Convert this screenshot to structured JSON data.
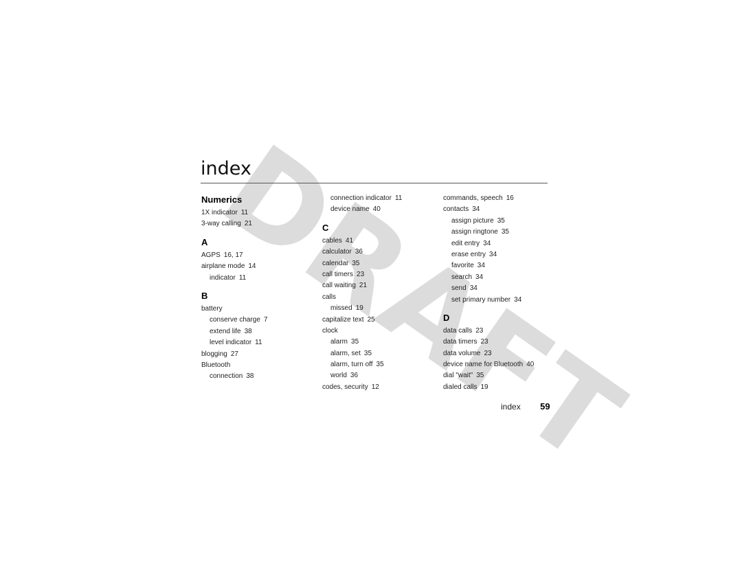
{
  "watermark": "DRAFT",
  "page_title": "index",
  "columns": [
    {
      "blocks": [
        {
          "heading": "Numerics",
          "entries": [
            {
              "term": "1X indicator",
              "pages": "11",
              "sub": false
            },
            {
              "term": "3-way calling",
              "pages": "21",
              "sub": false
            }
          ]
        },
        {
          "heading": "A",
          "entries": [
            {
              "term": "AGPS",
              "pages": "16, 17",
              "sub": false
            },
            {
              "term": "airplane mode",
              "pages": "14",
              "sub": false
            },
            {
              "term": "indicator",
              "pages": "11",
              "sub": true
            }
          ]
        },
        {
          "heading": "B",
          "entries": [
            {
              "term": "battery",
              "pages": "",
              "sub": false
            },
            {
              "term": "conserve charge",
              "pages": "7",
              "sub": true
            },
            {
              "term": "extend life",
              "pages": "38",
              "sub": true
            },
            {
              "term": "level indicator",
              "pages": "11",
              "sub": true
            },
            {
              "term": "blogging",
              "pages": "27",
              "sub": false
            },
            {
              "term": "Bluetooth",
              "pages": "",
              "sub": false
            },
            {
              "term": "connection",
              "pages": "38",
              "sub": true
            }
          ]
        }
      ]
    },
    {
      "blocks": [
        {
          "heading": "",
          "entries": [
            {
              "term": "connection indicator",
              "pages": "11",
              "sub": true
            },
            {
              "term": "device name",
              "pages": "40",
              "sub": true
            }
          ]
        },
        {
          "heading": "C",
          "entries": [
            {
              "term": "cables",
              "pages": "41",
              "sub": false
            },
            {
              "term": "calculator",
              "pages": "36",
              "sub": false
            },
            {
              "term": "calendar",
              "pages": "35",
              "sub": false
            },
            {
              "term": "call timers",
              "pages": "23",
              "sub": false
            },
            {
              "term": "call waiting",
              "pages": "21",
              "sub": false
            },
            {
              "term": "calls",
              "pages": "",
              "sub": false
            },
            {
              "term": "missed",
              "pages": "19",
              "sub": true
            },
            {
              "term": "capitalize text",
              "pages": "25",
              "sub": false
            },
            {
              "term": "clock",
              "pages": "",
              "sub": false
            },
            {
              "term": "alarm",
              "pages": "35",
              "sub": true
            },
            {
              "term": "alarm, set",
              "pages": "35",
              "sub": true
            },
            {
              "term": "alarm, turn off",
              "pages": "35",
              "sub": true
            },
            {
              "term": "world",
              "pages": "36",
              "sub": true
            },
            {
              "term": "codes, security",
              "pages": "12",
              "sub": false
            }
          ]
        }
      ]
    },
    {
      "blocks": [
        {
          "heading": "",
          "entries": [
            {
              "term": "commands, speech",
              "pages": "16",
              "sub": false
            },
            {
              "term": "contacts",
              "pages": "34",
              "sub": false
            },
            {
              "term": "assign picture",
              "pages": "35",
              "sub": true
            },
            {
              "term": "assign ringtone",
              "pages": "35",
              "sub": true
            },
            {
              "term": "edit entry",
              "pages": "34",
              "sub": true
            },
            {
              "term": "erase entry",
              "pages": "34",
              "sub": true
            },
            {
              "term": "favorite",
              "pages": "34",
              "sub": true
            },
            {
              "term": "search",
              "pages": "34",
              "sub": true
            },
            {
              "term": "send",
              "pages": "34",
              "sub": true
            },
            {
              "term": "set primary number",
              "pages": "34",
              "sub": true
            }
          ]
        },
        {
          "heading": "D",
          "entries": [
            {
              "term": "data calls",
              "pages": "23",
              "sub": false
            },
            {
              "term": "data timers",
              "pages": "23",
              "sub": false
            },
            {
              "term": "data volume",
              "pages": "23",
              "sub": false
            },
            {
              "term": "device name for Bluetooth",
              "pages": "40",
              "sub": false
            },
            {
              "term": "dial \"wait\"",
              "pages": "35",
              "sub": false
            },
            {
              "term": "dialed calls",
              "pages": "19",
              "sub": false
            }
          ]
        }
      ]
    }
  ],
  "footer": {
    "label": "index",
    "page_number": "59"
  },
  "colors": {
    "watermark": "#dcdcdc",
    "text": "#222222",
    "rule": "#555555"
  }
}
